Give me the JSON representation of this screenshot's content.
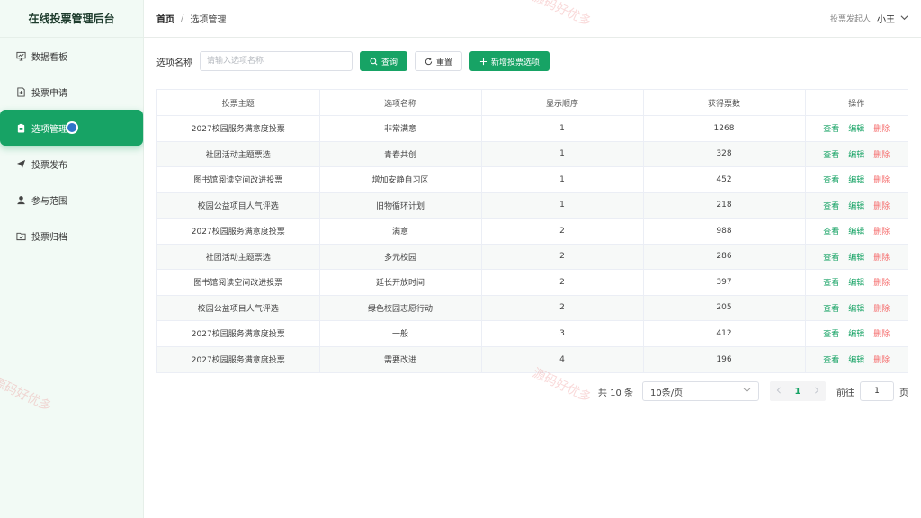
{
  "brand": "在线投票管理后台",
  "sidebar": {
    "items": [
      {
        "label": "数据看板",
        "icon": "dashboard-icon"
      },
      {
        "label": "投票申请",
        "icon": "file-plus-icon"
      },
      {
        "label": "选项管理",
        "icon": "clipboard-icon",
        "active": true
      },
      {
        "label": "投票发布",
        "icon": "send-icon"
      },
      {
        "label": "参与范围",
        "icon": "user-icon"
      },
      {
        "label": "投票归档",
        "icon": "folder-icon"
      }
    ]
  },
  "breadcrumb": {
    "home": "首页",
    "separator": "/",
    "current": "选项管理"
  },
  "user": {
    "role": "投票发起人",
    "name": "小王"
  },
  "filter": {
    "label": "选项名称",
    "placeholder": "请输入选项名称",
    "value": "",
    "search_label": "查询",
    "reset_label": "重置",
    "add_label": "新增投票选项"
  },
  "table": {
    "columns": [
      "投票主题",
      "选项名称",
      "显示顺序",
      "获得票数",
      "操作"
    ],
    "rows": [
      {
        "topic": "2027校园服务满意度投票",
        "option": "非常满意",
        "order": "1",
        "votes": "1268"
      },
      {
        "topic": "社团活动主题票选",
        "option": "青春共创",
        "order": "1",
        "votes": "328"
      },
      {
        "topic": "图书馆阅读空间改进投票",
        "option": "增加安静自习区",
        "order": "1",
        "votes": "452"
      },
      {
        "topic": "校园公益项目人气评选",
        "option": "旧物循环计划",
        "order": "1",
        "votes": "218"
      },
      {
        "topic": "2027校园服务满意度投票",
        "option": "满意",
        "order": "2",
        "votes": "988"
      },
      {
        "topic": "社团活动主题票选",
        "option": "多元校园",
        "order": "2",
        "votes": "286"
      },
      {
        "topic": "图书馆阅读空间改进投票",
        "option": "延长开放时间",
        "order": "2",
        "votes": "397"
      },
      {
        "topic": "校园公益项目人气评选",
        "option": "绿色校园志愿行动",
        "order": "2",
        "votes": "205"
      },
      {
        "topic": "2027校园服务满意度投票",
        "option": "一般",
        "order": "3",
        "votes": "412"
      },
      {
        "topic": "2027校园服务满意度投票",
        "option": "需要改进",
        "order": "4",
        "votes": "196"
      }
    ],
    "actions": {
      "view": "查看",
      "edit": "编辑",
      "delete": "删除"
    }
  },
  "pagination": {
    "total": "共 10 条",
    "page_size": "10条/页",
    "current_page": "1",
    "goto_label": "前往",
    "goto_value": "1",
    "page_suffix": "页"
  },
  "watermark": "源码好优多",
  "colors": {
    "primary": "#17a365",
    "danger": "#f56c6c",
    "sidebar_bg": "#f2faf5"
  }
}
